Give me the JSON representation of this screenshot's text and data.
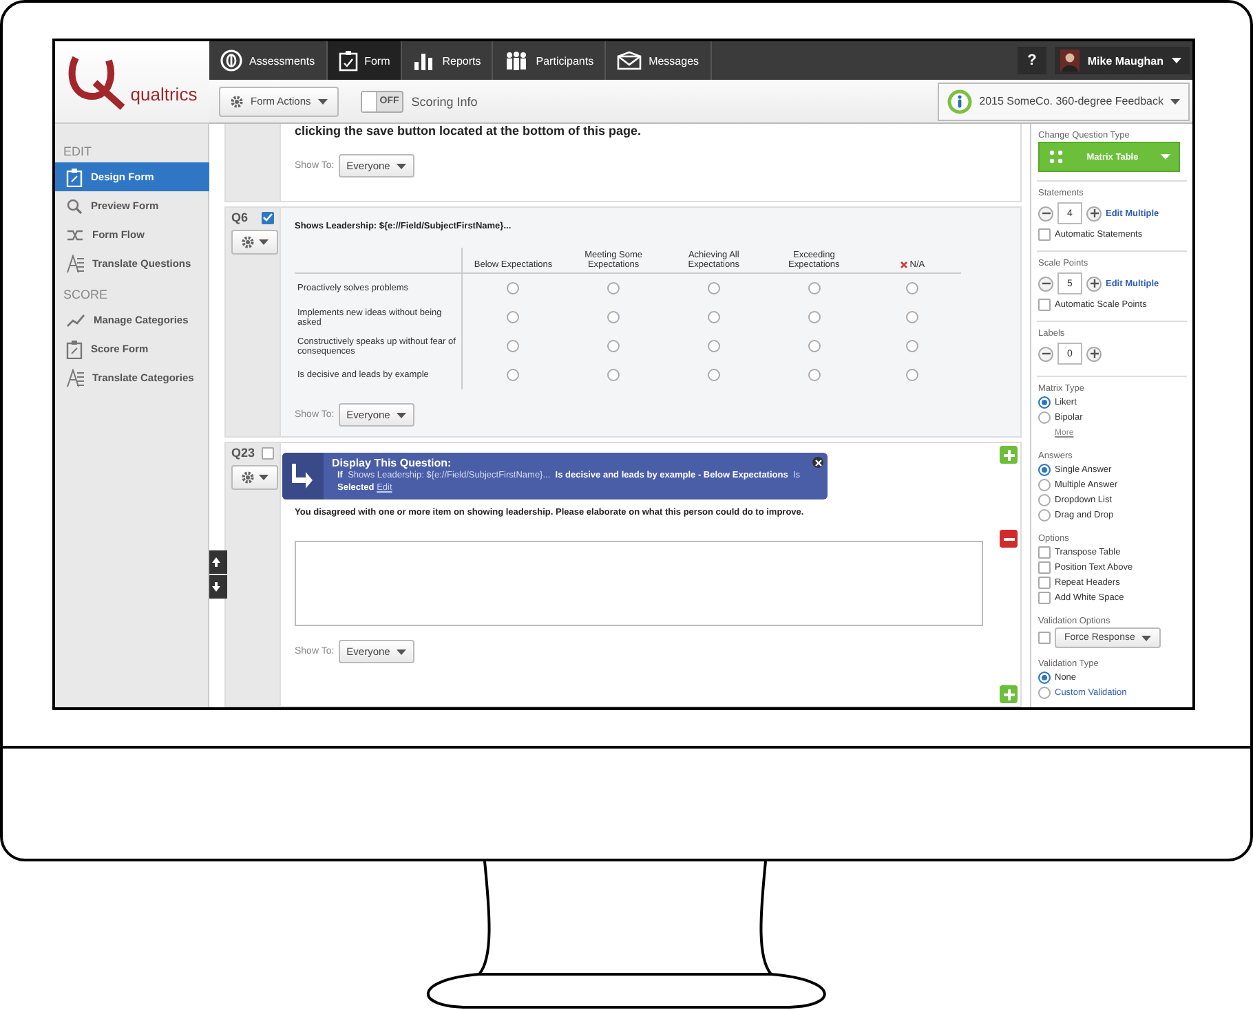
{
  "logo": {
    "word": "qualtrics"
  },
  "nav": {
    "items": [
      {
        "label": "Assessments",
        "selected": false
      },
      {
        "label": "Form",
        "selected": true
      },
      {
        "label": "Reports",
        "selected": false
      },
      {
        "label": "Participants",
        "selected": false
      },
      {
        "label": "Messages",
        "selected": false
      }
    ],
    "help": "?",
    "user": "Mike Maughan"
  },
  "toolbar": {
    "form_actions": "Form Actions",
    "scoring": {
      "on": false,
      "label": "OFF"
    },
    "scoring_label": "Scoring Info",
    "project": "2015 SomeCo. 360-degree Feedback"
  },
  "sidebar": {
    "sections": [
      {
        "title": "EDIT",
        "items": [
          {
            "label": "Design Form",
            "selected": true
          },
          {
            "label": "Preview Form",
            "selected": false
          },
          {
            "label": "Form Flow",
            "selected": false
          },
          {
            "label": "Translate Questions",
            "selected": false
          }
        ]
      },
      {
        "title": "SCORE",
        "items": [
          {
            "label": "Manage Categories",
            "selected": false
          },
          {
            "label": "Score Form",
            "selected": false
          },
          {
            "label": "Translate Categories",
            "selected": false
          }
        ]
      }
    ]
  },
  "questions": [
    {
      "kind": "partial",
      "text": "clicking the save button located at the bottom of this page.",
      "show_to_label": "Show To:",
      "show_to": "Everyone"
    },
    {
      "kind": "matrix",
      "number": "Q6",
      "checked": true,
      "title": "Shows Leadership: ${e://Field/SubjectFirstName}...",
      "columns": [
        "Below Expectations",
        "Meeting Some Expectations",
        "Achieving All Expectations",
        "Exceeding Expectations"
      ],
      "na_column": "N/A",
      "rows": [
        {
          "label": "Proactively solves problems",
          "selected": [
            false,
            false,
            false,
            false,
            false
          ]
        },
        {
          "label": "Implements new ideas without being asked",
          "selected": [
            false,
            false,
            false,
            false,
            false
          ]
        },
        {
          "label": "Constructively speaks up without fear of consequences",
          "selected": [
            false,
            false,
            false,
            false,
            false
          ]
        },
        {
          "label": "Is decisive and leads by example",
          "selected": [
            false,
            false,
            false,
            false,
            false
          ]
        }
      ],
      "show_to_label": "Show To:",
      "show_to": "Everyone"
    },
    {
      "kind": "text_entry",
      "number": "Q23",
      "checked": false,
      "display_logic": {
        "title": "Display This Question:",
        "rule": "**If**  Shows Leadership: ${e://Field/SubjectFirstName}...  **Is decisive and leads by example - Below Expectations**  Is  **Selected**",
        "edit": "Edit"
      },
      "text": "You disagreed with one or more item on showing leadership. Please elaborate on what this person could do to improve.",
      "show_to_label": "Show To:",
      "show_to": "Everyone"
    }
  ],
  "panel": {
    "sections": [
      {
        "title": "Change Question Type",
        "controls": [
          {
            "kind": "type_dropdown",
            "label": "Matrix Table"
          }
        ]
      },
      {
        "title": "Statements",
        "controls": [
          {
            "kind": "stepper",
            "value": "4",
            "link": "Edit Multiple"
          },
          {
            "kind": "checkbox",
            "label": "Automatic Statements",
            "checked": false
          }
        ]
      },
      {
        "title": "Scale Points",
        "controls": [
          {
            "kind": "stepper",
            "value": "5",
            "link": "Edit Multiple"
          },
          {
            "kind": "checkbox",
            "label": "Automatic Scale Points",
            "checked": false
          }
        ]
      },
      {
        "title": "Labels",
        "controls": [
          {
            "kind": "stepper",
            "value": "0"
          }
        ]
      },
      {
        "title": "Matrix Type",
        "controls": [
          {
            "kind": "radio",
            "label": "Likert",
            "selected": true
          },
          {
            "kind": "radio",
            "label": "Bipolar",
            "selected": false
          },
          {
            "kind": "more",
            "label": "More"
          }
        ]
      },
      {
        "title": "Answers",
        "controls": [
          {
            "kind": "radio",
            "label": "Single Answer",
            "selected": true
          },
          {
            "kind": "radio",
            "label": "Multiple Answer",
            "selected": false
          },
          {
            "kind": "radio",
            "label": "Dropdown List",
            "selected": false
          },
          {
            "kind": "radio",
            "label": "Drag and Drop",
            "selected": false
          }
        ]
      },
      {
        "title": "Options",
        "controls": [
          {
            "kind": "checkbox",
            "label": "Transpose Table",
            "checked": false
          },
          {
            "kind": "checkbox",
            "label": "Position Text Above",
            "checked": false
          },
          {
            "kind": "checkbox",
            "label": "Repeat Headers",
            "checked": false
          },
          {
            "kind": "checkbox",
            "label": "Add White Space",
            "checked": false
          }
        ]
      },
      {
        "title": "Validation Options",
        "controls": [
          {
            "kind": "check_dropdown",
            "label": "Force Response",
            "checked": false
          }
        ]
      },
      {
        "title": "Validation Type",
        "controls": [
          {
            "kind": "radio",
            "label": "None",
            "selected": true
          },
          {
            "kind": "radio_link",
            "label": "Custom Validation",
            "selected": false
          }
        ]
      }
    ]
  }
}
